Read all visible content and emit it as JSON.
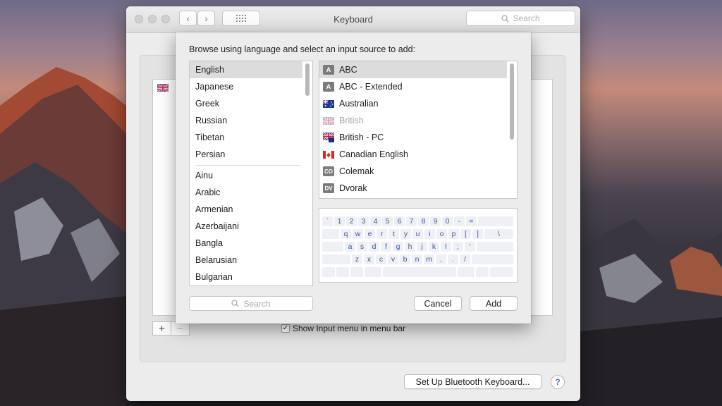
{
  "window": {
    "title": "Keyboard",
    "search_placeholder": "Search",
    "show_input_menu_label": "Show Input menu in menu bar",
    "show_input_menu_checked": true,
    "bluetooth_button_label": "Set Up Bluetooth Keyboard...",
    "help_label": "?",
    "add_label": "+",
    "remove_label": "−",
    "back_label": "‹",
    "forward_label": "›"
  },
  "sheet": {
    "prompt": "Browse using language and select an input source to add:",
    "languages_top": [
      "English",
      "Japanese",
      "Greek",
      "Russian",
      "Tibetan",
      "Persian"
    ],
    "languages": [
      "Ainu",
      "Arabic",
      "Armenian",
      "Azerbaijani",
      "Bangla",
      "Belarusian",
      "Bulgarian"
    ],
    "selected_language": "English",
    "sources": [
      {
        "label": "ABC",
        "badge": "A",
        "icon": "abc-badge-icon",
        "selected": true,
        "dimmed": false
      },
      {
        "label": "ABC - Extended",
        "badge": "A",
        "icon": "abc-extended-badge-icon",
        "selected": false,
        "dimmed": false
      },
      {
        "label": "Australian",
        "badge": "",
        "icon": "australia-flag-icon",
        "selected": false,
        "dimmed": false
      },
      {
        "label": "British",
        "badge": "",
        "icon": "uk-flag-icon",
        "selected": false,
        "dimmed": true
      },
      {
        "label": "British - PC",
        "badge": "",
        "icon": "uk-pc-flag-icon",
        "selected": false,
        "dimmed": false
      },
      {
        "label": "Canadian English",
        "badge": "",
        "icon": "canada-flag-icon",
        "selected": false,
        "dimmed": false
      },
      {
        "label": "Colemak",
        "badge": "CO",
        "icon": "colemak-badge-icon",
        "selected": false,
        "dimmed": false
      },
      {
        "label": "Dvorak",
        "badge": "DV",
        "icon": "dvorak-badge-icon",
        "selected": false,
        "dimmed": false
      }
    ],
    "keyboard_rows": [
      [
        "`",
        "1",
        "2",
        "3",
        "4",
        "5",
        "6",
        "7",
        "8",
        "9",
        "0",
        "-",
        "="
      ],
      [
        "q",
        "w",
        "e",
        "r",
        "t",
        "y",
        "u",
        "i",
        "o",
        "p",
        "[",
        "]",
        "\\"
      ],
      [
        "a",
        "s",
        "d",
        "f",
        "g",
        "h",
        "j",
        "k",
        "l",
        ";",
        "'"
      ],
      [
        "z",
        "x",
        "c",
        "v",
        "b",
        "n",
        "m",
        ",",
        ".",
        "/"
      ]
    ],
    "search_placeholder": "Search",
    "cancel_label": "Cancel",
    "add_label": "Add"
  },
  "colors": {
    "selection_gray": "#dcdcdc",
    "key_text_blue": "#3c5aa0",
    "help_blue": "#3a7bd5"
  }
}
